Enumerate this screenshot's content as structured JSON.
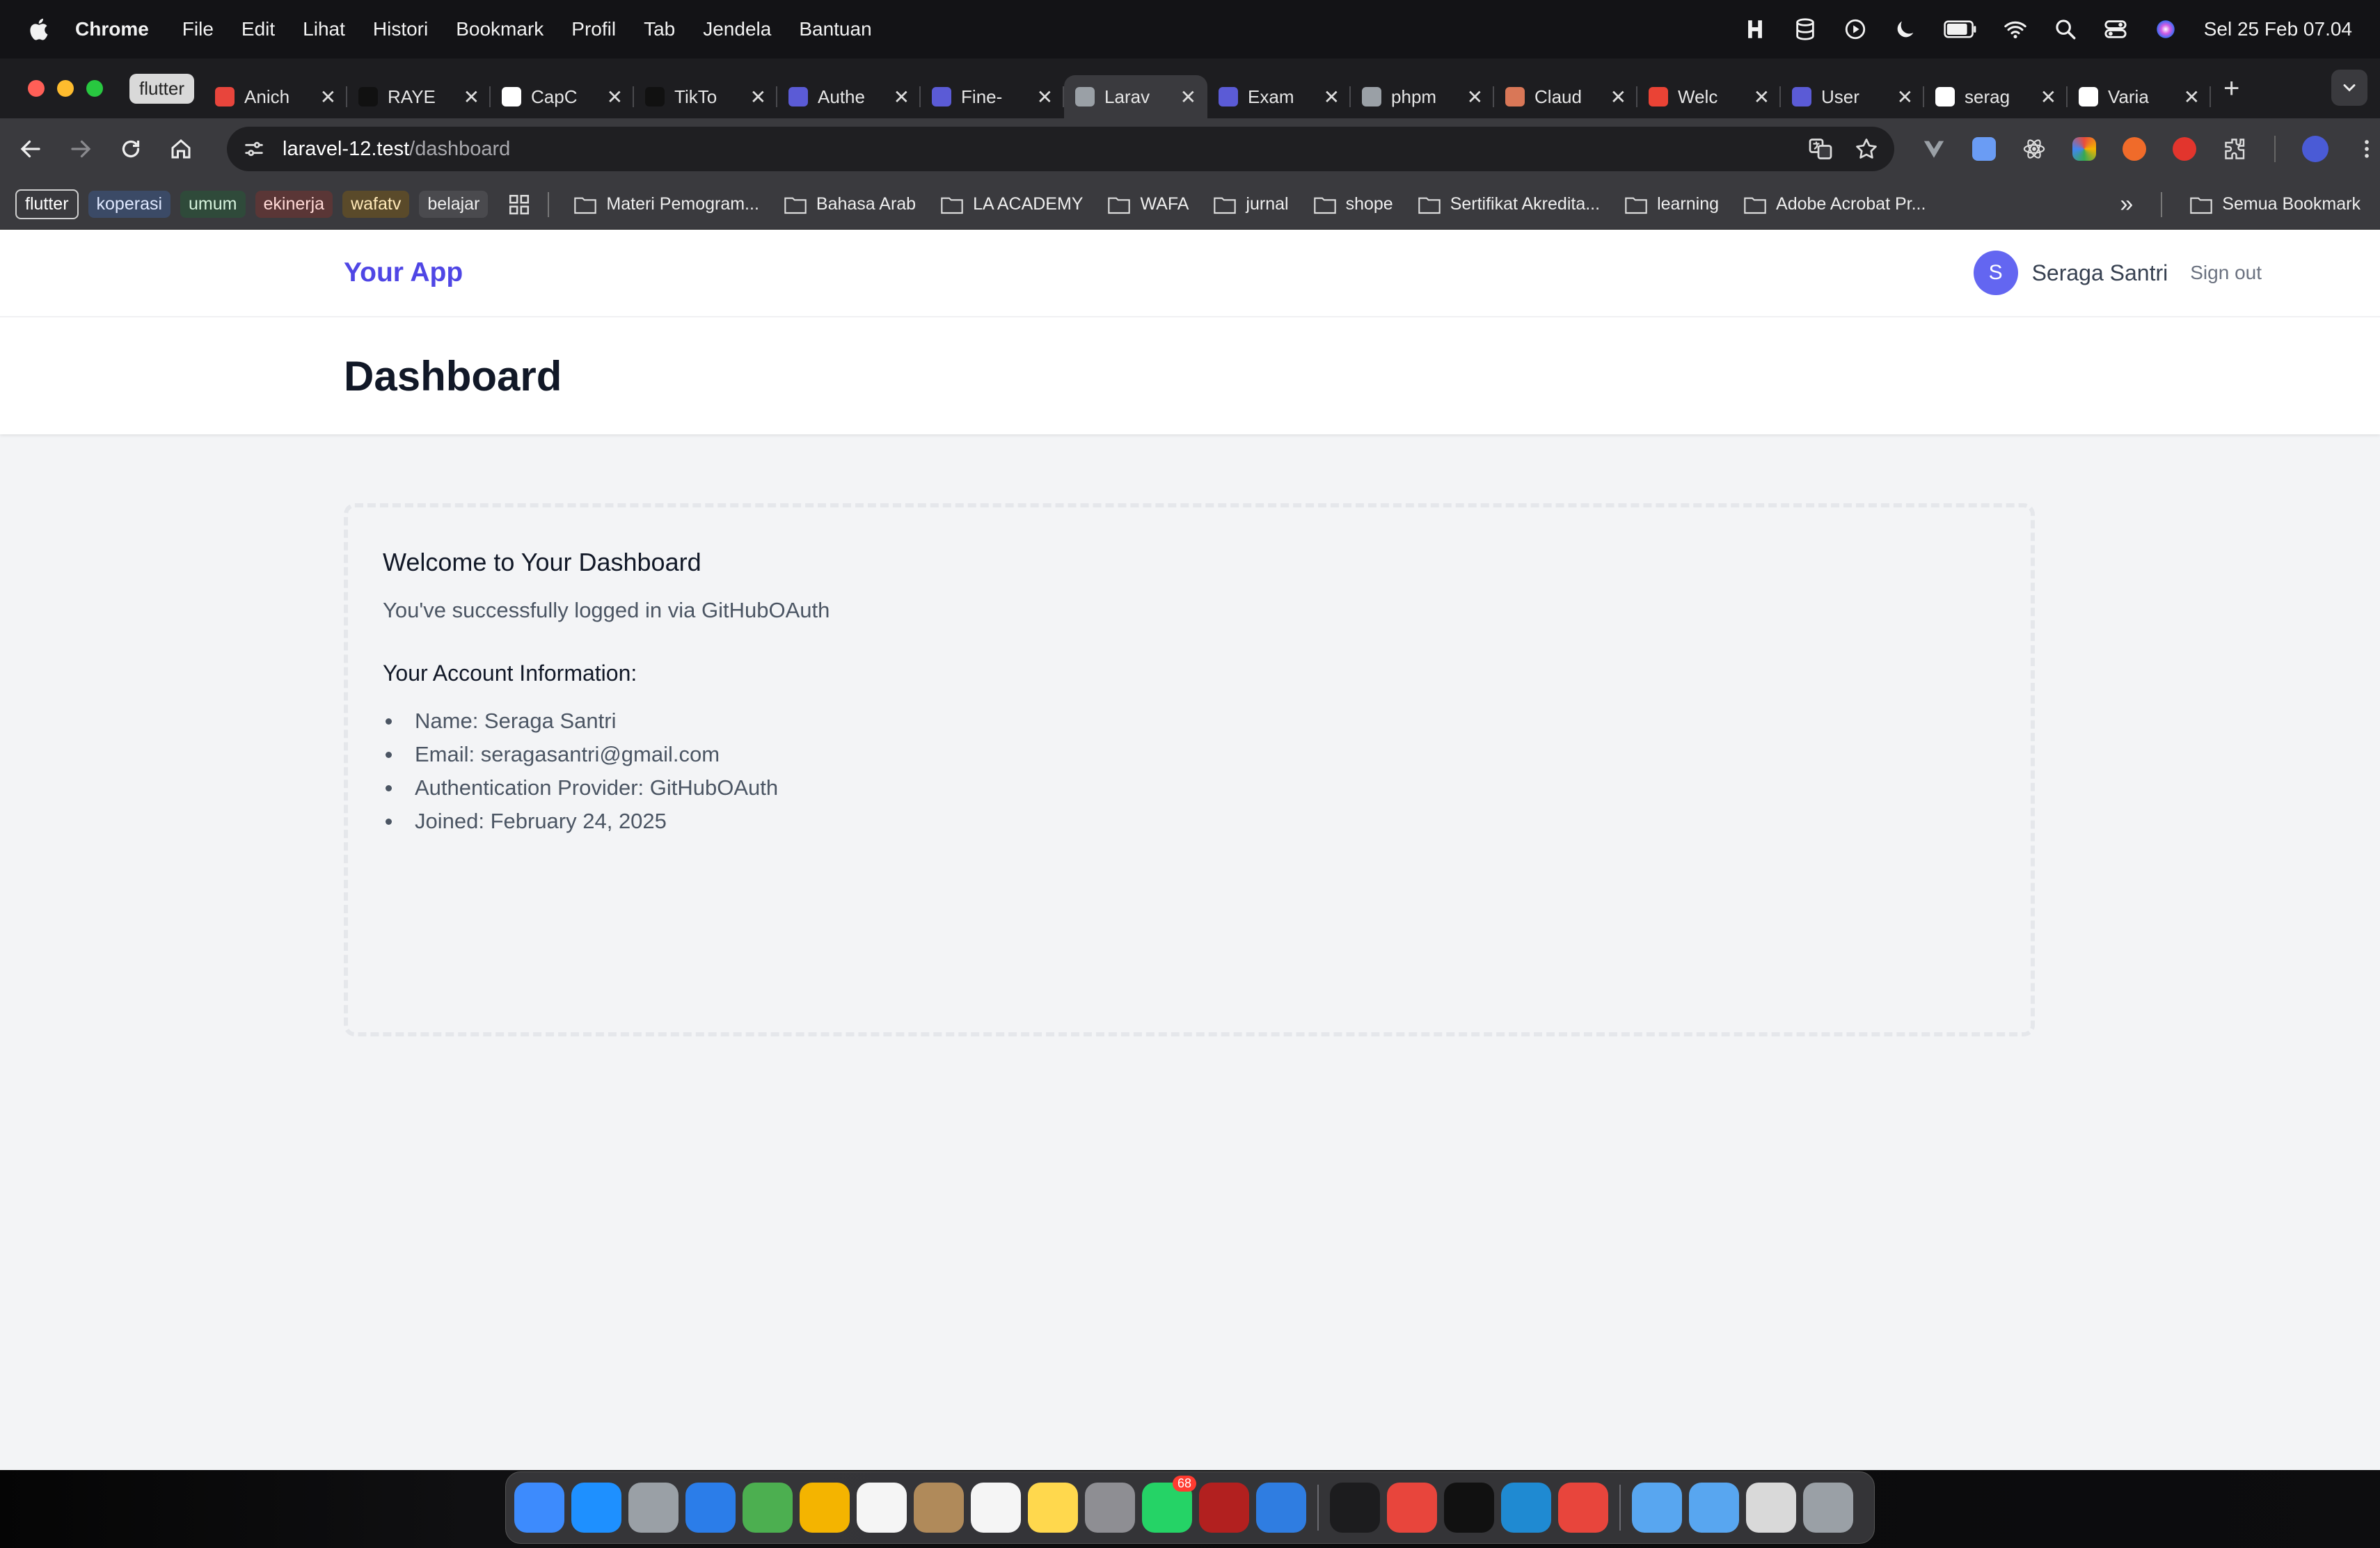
{
  "menubar": {
    "app": "Chrome",
    "items": [
      "File",
      "Edit",
      "Lihat",
      "Histori",
      "Bookmark",
      "Profil",
      "Tab",
      "Jendela",
      "Bantuan"
    ],
    "clock": "Sel 25 Feb  07.04"
  },
  "tabs": {
    "group_label": "flutter",
    "items": [
      {
        "title": "Anich",
        "color": "#e8453c"
      },
      {
        "title": "RAYE",
        "color": "#111111"
      },
      {
        "title": "CapC",
        "color": "#ffffff"
      },
      {
        "title": "TikTo",
        "color": "#111111"
      },
      {
        "title": "Authe",
        "color": "#5b5bd6"
      },
      {
        "title": "Fine-",
        "color": "#5b5bd6"
      },
      {
        "title": "Larav",
        "color": "#9aa0a6",
        "active": true
      },
      {
        "title": "Exam",
        "color": "#5b5bd6"
      },
      {
        "title": "phpm",
        "color": "#9aa0a6"
      },
      {
        "title": "Claud",
        "color": "#d97757"
      },
      {
        "title": "Welc",
        "color": "#ea4335"
      },
      {
        "title": "User",
        "color": "#5b5bd6"
      },
      {
        "title": "serag",
        "color": "#ffffff"
      },
      {
        "title": "Varia",
        "color": "#ffffff"
      }
    ],
    "close_glyph": "✕",
    "new_tab_glyph": "+"
  },
  "toolbar": {
    "url_host": "laravel-12.test",
    "url_path": "/dashboard"
  },
  "bookmarks": {
    "groups": [
      {
        "label": "flutter",
        "bg": "#3a3a3e",
        "fg": "#ffffff",
        "border": "#cfcfcf"
      },
      {
        "label": "koperasi",
        "bg": "#3b4a66",
        "fg": "#dfe8ff"
      },
      {
        "label": "umum",
        "bg": "#2f4a3a",
        "fg": "#d6f2dc"
      },
      {
        "label": "ekinerja",
        "bg": "#5a3636",
        "fg": "#ffd9d6"
      },
      {
        "label": "wafatv",
        "bg": "#5a4a2a",
        "fg": "#ffe9b8"
      },
      {
        "label": "belajar",
        "bg": "#4a4a4e",
        "fg": "#eeeeee"
      }
    ],
    "folders": [
      "Materi Pemogram...",
      "Bahasa Arab",
      "LA ACADEMY",
      "WAFA",
      "jurnal",
      "shope",
      "Sertifikat Akredita...",
      "learning",
      "Adobe Acrobat Pr..."
    ],
    "overflow": "»",
    "all_bookmarks": "Semua Bookmark"
  },
  "app": {
    "brand": "Your App",
    "user_initial": "S",
    "user_name": "Seraga Santri",
    "sign_out": "Sign out",
    "page_title": "Dashboard",
    "welcome_title": "Welcome to Your Dashboard",
    "welcome_text": "You've successfully logged in via GitHubOAuth",
    "account_heading": "Your Account Information:",
    "account_items": [
      "Name: Seraga Santri",
      "Email: seragasantri@gmail.com",
      "Authentication Provider: GitHubOAuth",
      "Joined: February 24, 2025"
    ],
    "brand_color": "#4f46e5"
  },
  "dock": {
    "apps": [
      {
        "name": "finder",
        "color": "#3d8bfd"
      },
      {
        "name": "app-store",
        "color": "#1e90ff"
      },
      {
        "name": "launchpad",
        "color": "#9aa0a6"
      },
      {
        "name": "safari",
        "color": "#2b7de9"
      },
      {
        "name": "maps",
        "color": "#4caf50"
      },
      {
        "name": "photos",
        "color": "#f4b400"
      },
      {
        "name": "calendar",
        "color": "#f5f5f5"
      },
      {
        "name": "contacts",
        "color": "#b08a5a"
      },
      {
        "name": "reminders",
        "color": "#f5f5f5"
      },
      {
        "name": "notes",
        "color": "#ffd84d"
      },
      {
        "name": "system-settings",
        "color": "#8e8e93"
      },
      {
        "name": "whatsapp",
        "color": "#25d366",
        "badge": "68"
      },
      {
        "name": "filezilla",
        "color": "#b2201f"
      },
      {
        "name": "xcode",
        "color": "#2f7de1"
      },
      {
        "name": "terminal",
        "color": "#1c1c1e"
      },
      {
        "name": "chrome",
        "color": "#e8453c"
      },
      {
        "name": "capcut",
        "color": "#111111"
      },
      {
        "name": "vscode",
        "color": "#1f8ad2"
      },
      {
        "name": "herd",
        "color": "#e8453c"
      },
      {
        "name": "folder-1",
        "color": "#58a6f0"
      },
      {
        "name": "folder-2",
        "color": "#58a6f0"
      },
      {
        "name": "preview",
        "color": "#d9d9d9"
      },
      {
        "name": "trash",
        "color": "#9aa0a6"
      }
    ]
  }
}
